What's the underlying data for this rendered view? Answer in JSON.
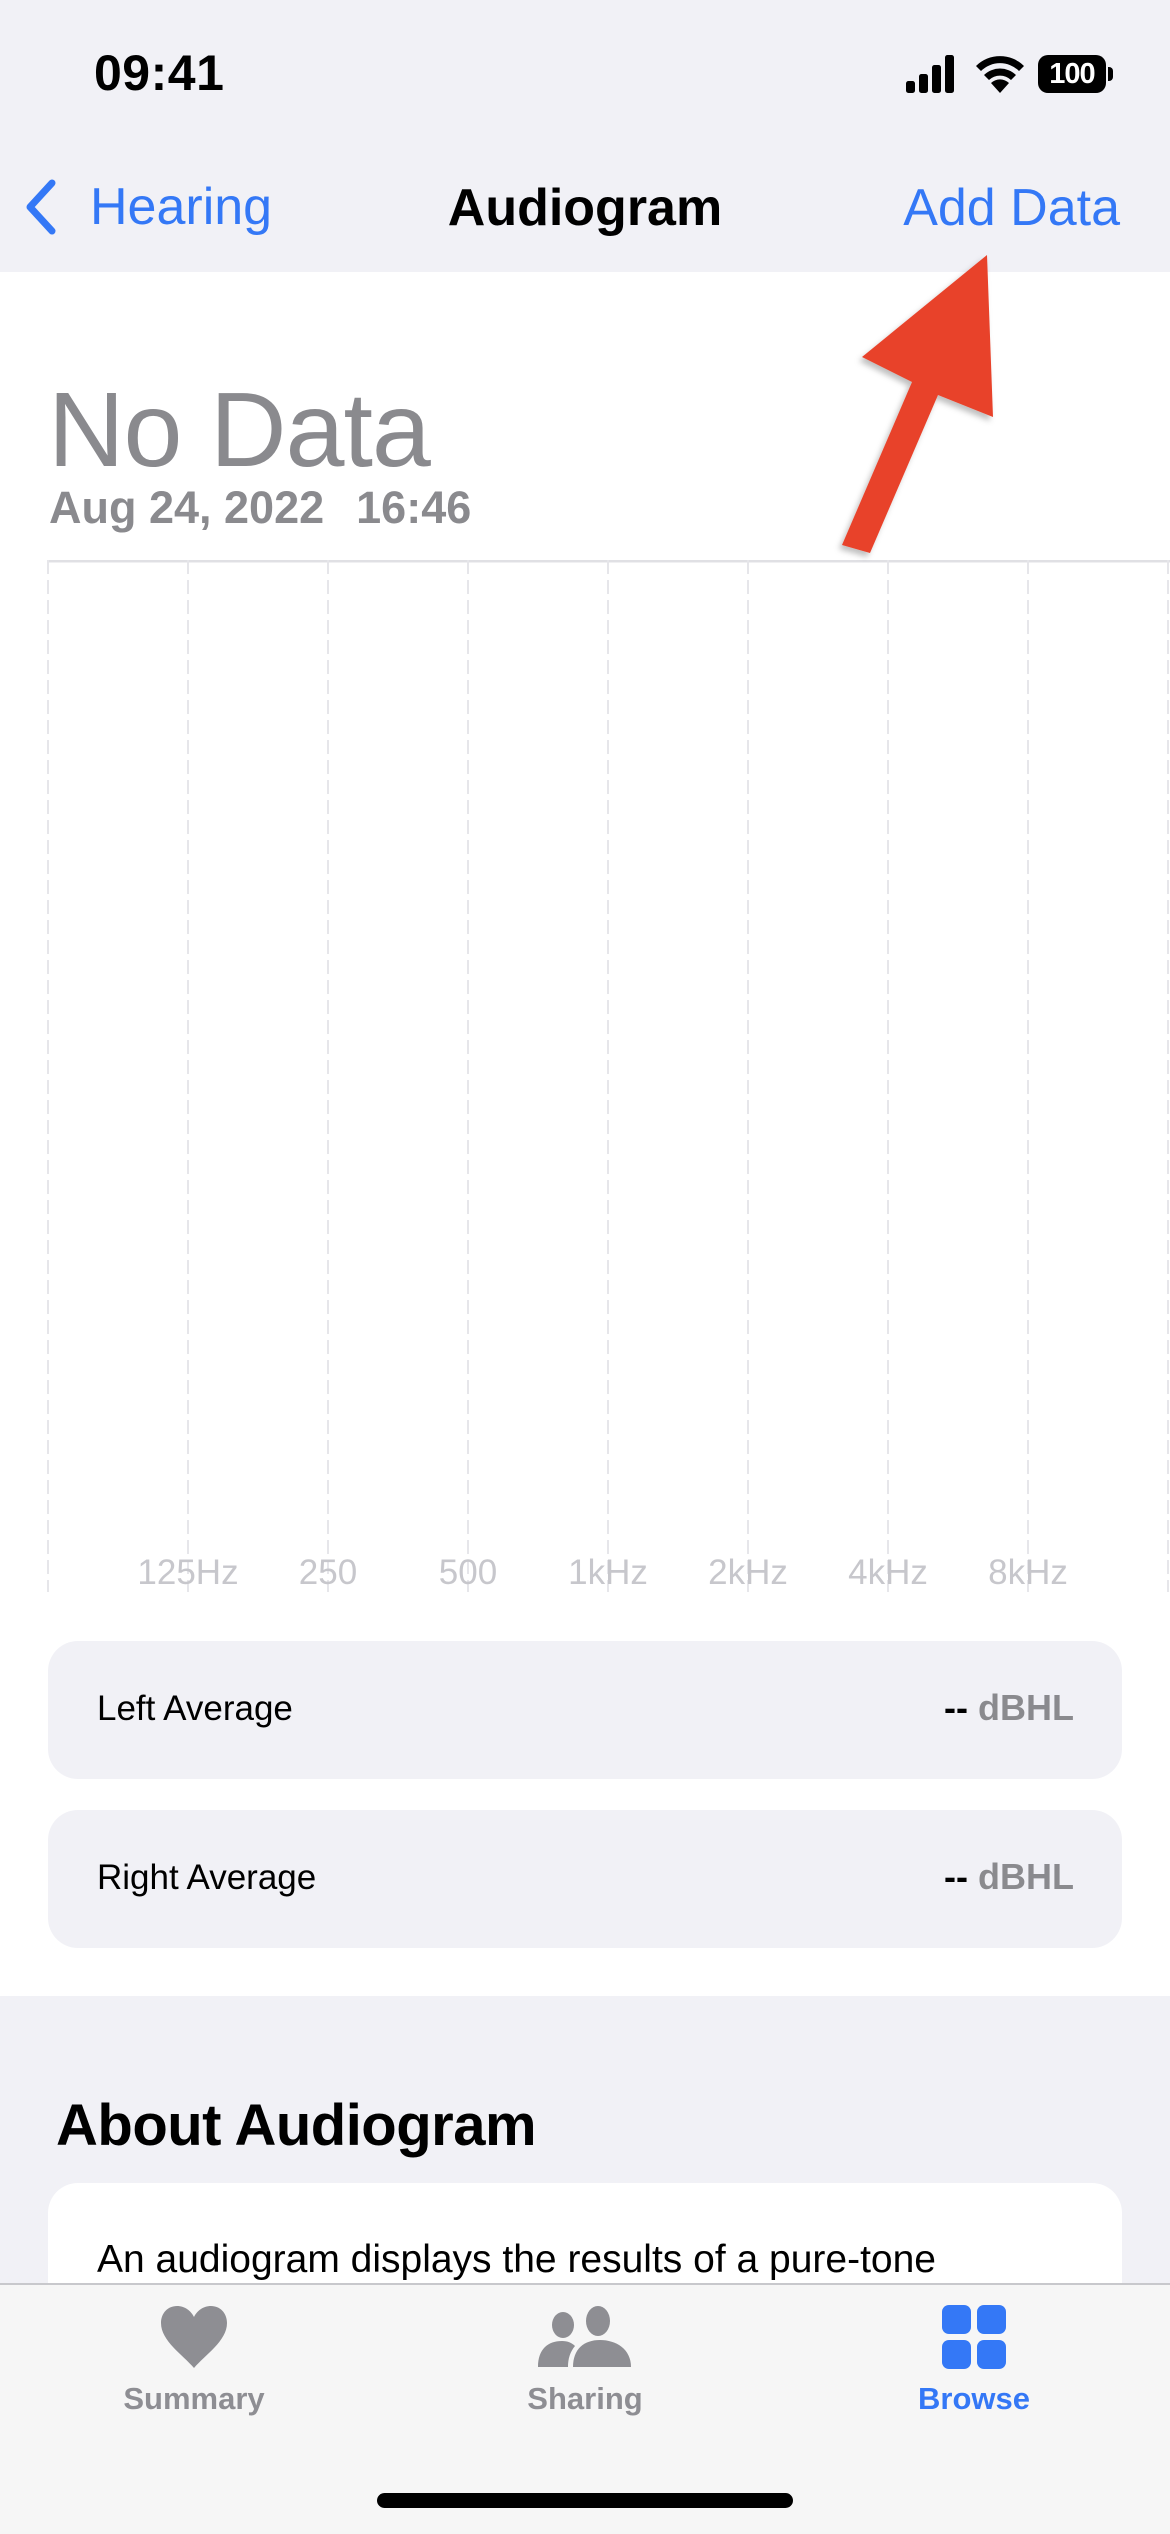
{
  "status_bar": {
    "time": "09:41",
    "battery_level": "100",
    "icons": [
      "cellular-signal-icon",
      "wifi-icon",
      "battery-icon"
    ]
  },
  "nav": {
    "back_label": "Hearing",
    "back_icon": "chevron-left-icon",
    "title": "Audiogram",
    "action_label": "Add Data"
  },
  "summary": {
    "headline": "No Data",
    "date": "Aug 24, 2022",
    "time": "16:46"
  },
  "chart_data": {
    "type": "scatter",
    "title": "",
    "xlabel": "",
    "ylabel": "",
    "x_scale": "log2",
    "tick_labels": [
      "125Hz",
      "250",
      "500",
      "1kHz",
      "2kHz",
      "4kHz",
      "8kHz"
    ],
    "frequencies_hz": [
      125,
      250,
      500,
      1000,
      2000,
      4000,
      8000
    ],
    "series": [],
    "grid": true,
    "grid_style": "dashed-vertical",
    "empty_state": true
  },
  "stats": [
    {
      "label": "Left Average",
      "value": "--",
      "unit": "dBHL"
    },
    {
      "label": "Right Average",
      "value": "--",
      "unit": "dBHL"
    }
  ],
  "about": {
    "title": "About Audiogram",
    "text": "An audiogram displays the results of a pure-tone"
  },
  "tab_bar": {
    "tabs": [
      {
        "label": "Summary",
        "icon": "heart-icon",
        "active": false
      },
      {
        "label": "Sharing",
        "icon": "people-icon",
        "active": false
      },
      {
        "label": "Browse",
        "icon": "grid-icon",
        "active": true
      }
    ]
  },
  "colors": {
    "accent": "#3478F6",
    "secondary_text": "#8A8A8E",
    "tick_text": "#C7C7CC",
    "annotation_arrow": "#E8432B",
    "grouped_background": "#F1F1F6"
  },
  "annotation": {
    "type": "arrow",
    "points_to": "Add Data"
  }
}
